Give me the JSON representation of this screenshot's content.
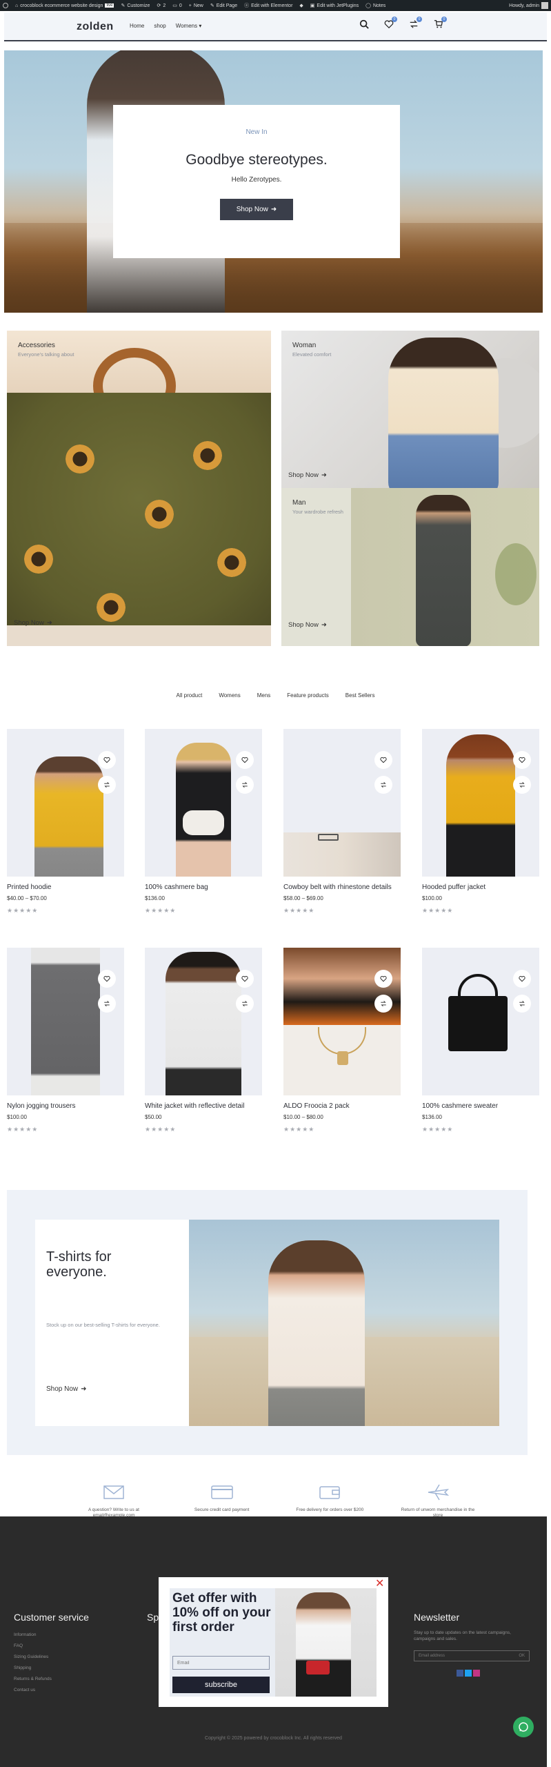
{
  "admin_bar": {
    "items": [
      "crocoblock ecommerce website design",
      "Customize",
      "2",
      "0",
      "New",
      "Edit Page",
      "Edit with Elementor",
      "Edit with JetPlugins",
      "Notes"
    ],
    "badge": "live",
    "greeting": "Howdy, admin"
  },
  "header": {
    "logo": "zolden",
    "nav": [
      "Home",
      "shop",
      "Womens"
    ],
    "badges": {
      "wishlist": "0",
      "compare": "0",
      "cart": "0"
    }
  },
  "hero": {
    "kicker": "New In",
    "title": "Goodbye stereotypes.",
    "subtitle": "Hello Zerotypes.",
    "button": "Shop Now"
  },
  "categories": {
    "accessories": {
      "title": "Accessories",
      "subtitle": "Everyone's talking about",
      "button": "Shop Now"
    },
    "woman": {
      "title": "Woman",
      "subtitle": "Elevated comfort",
      "button": "Shop Now"
    },
    "man": {
      "title": "Man",
      "subtitle": "Your wardrobe refresh",
      "button": "Shop Now"
    }
  },
  "filter_tabs": [
    "All product",
    "Womens",
    "Mens",
    "Feature products",
    "Best Sellers"
  ],
  "products": [
    {
      "name": "Printed hoodie",
      "price": "$40.00 – $70.00",
      "stars": "★★★★★"
    },
    {
      "name": "100% cashmere bag",
      "price": "$136.00",
      "stars": "★★★★★"
    },
    {
      "name": "Cowboy belt with rhinestone details",
      "price": "$58.00 – $69.00",
      "stars": "★★★★★"
    },
    {
      "name": "Hooded puffer jacket",
      "price": "$100.00",
      "stars": "★★★★★"
    },
    {
      "name": "Nylon jogging trousers",
      "price": "$100.00",
      "stars": "★★★★★"
    },
    {
      "name": "White jacket with reflective detail",
      "price": "$50.00",
      "stars": "★★★★★"
    },
    {
      "name": "ALDO Froocia 2 pack",
      "price": "$10.00 – $80.00",
      "stars": "★★★★★"
    },
    {
      "name": "100% cashmere sweater",
      "price": "$136.00",
      "stars": "★★★★★"
    }
  ],
  "promo": {
    "title": "T-shirts for everyone.",
    "text": "Stock up on our best-selling T-shirts for everyone.",
    "button": "Shop Now"
  },
  "features": [
    "A question? Write to us at email@example.com",
    "Secure credit card payment",
    "Free delivery for orders over $200",
    "Return of unworn merchandise in the store"
  ],
  "footer": {
    "customer_service": {
      "title": "Customer service",
      "links": [
        "Information",
        "FAQ",
        "Sizing Guidelines",
        "Shipping",
        "Returns & Refunds",
        "Contact us"
      ]
    },
    "second_col_title": "Sp",
    "newsletter": {
      "title": "Newsletter",
      "text": "Stay up to date updates on the latest campaigns, campaigns and sales.",
      "placeholder": "Email address",
      "button": "OK"
    },
    "copyright": "Copyright © 2025 powered by crocoblock Inc. All rights reserved"
  },
  "modal": {
    "title": "Get offer with 10% off on your first order",
    "email_placeholder": "Email",
    "button": "subscribe",
    "close": "✕"
  },
  "colors": {
    "accent": "#3a3e4a",
    "kicker": "#7a93b8",
    "footer_bg": "#2b2b2b",
    "close": "#d9302c"
  }
}
